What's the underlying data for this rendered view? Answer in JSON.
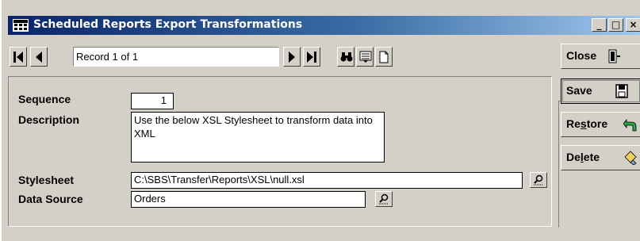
{
  "window": {
    "title": "Scheduled Reports Export Transformations",
    "controls": {
      "minimize": "_",
      "maximize": "□",
      "close": "×"
    }
  },
  "navigation": {
    "record_text": "Record 1 of 1",
    "icons": [
      "first-record-icon",
      "previous-record-icon",
      "next-record-icon",
      "last-record-icon",
      "binoculars-icon",
      "list-view-icon",
      "new-record-icon"
    ]
  },
  "form": {
    "sequence": {
      "label": "Sequence",
      "value": "1"
    },
    "description": {
      "label": "Description",
      "value": "Use the below XSL Stylesheet to transform data into XML"
    },
    "stylesheet": {
      "label": "Stylesheet",
      "value": "C:\\SBS\\Transfer\\Reports\\XSL\\null.xsl"
    },
    "data_source": {
      "label": "Data Source",
      "value": "Orders"
    }
  },
  "actions": {
    "close": {
      "pre": "Close",
      "access": "",
      "post": ""
    },
    "save": {
      "pre": "Save",
      "access": "",
      "post": ""
    },
    "restore": {
      "pre": "Re",
      "access": "s",
      "post": "tore"
    },
    "delete": {
      "pre": "De",
      "access": "l",
      "post": "ete"
    }
  },
  "colors": {
    "titlebar_start": "#0a246a",
    "titlebar_end": "#a6caf0",
    "face": "#d4d0c8"
  }
}
